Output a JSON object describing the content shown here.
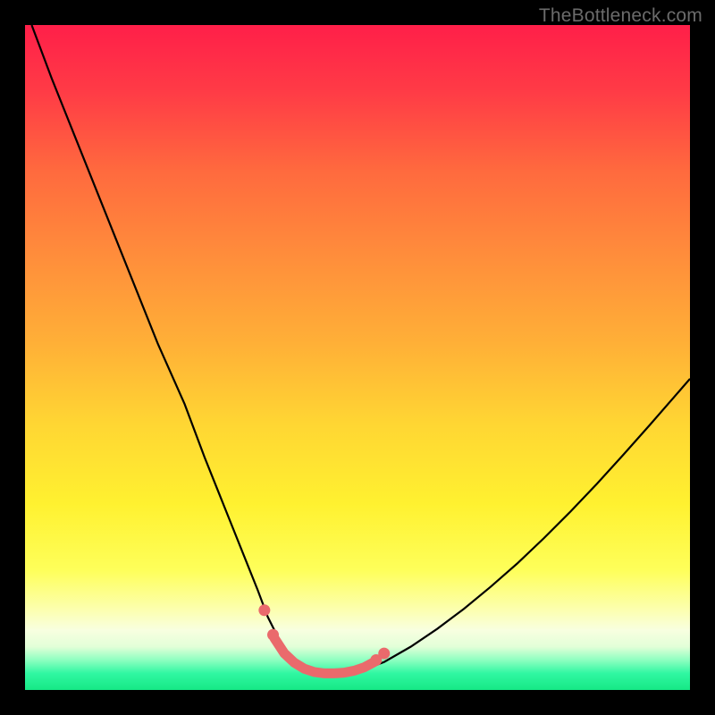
{
  "watermark": {
    "text": "TheBottleneck.com"
  },
  "gradient": {
    "stops": [
      {
        "offset": 0.0,
        "color": "#ff1f49"
      },
      {
        "offset": 0.1,
        "color": "#ff3b46"
      },
      {
        "offset": 0.22,
        "color": "#ff6a3e"
      },
      {
        "offset": 0.35,
        "color": "#ff8e3b"
      },
      {
        "offset": 0.48,
        "color": "#ffb037"
      },
      {
        "offset": 0.6,
        "color": "#ffd633"
      },
      {
        "offset": 0.72,
        "color": "#fff130"
      },
      {
        "offset": 0.82,
        "color": "#feff5a"
      },
      {
        "offset": 0.88,
        "color": "#fcffb0"
      },
      {
        "offset": 0.91,
        "color": "#f8ffe0"
      },
      {
        "offset": 0.935,
        "color": "#e2ffd8"
      },
      {
        "offset": 0.955,
        "color": "#8dffc0"
      },
      {
        "offset": 0.975,
        "color": "#30f7a2"
      },
      {
        "offset": 1.0,
        "color": "#16e885"
      }
    ]
  },
  "chart_data": {
    "type": "line",
    "title": "",
    "xlabel": "",
    "ylabel": "",
    "xlim": [
      0,
      100
    ],
    "ylim": [
      0,
      100
    ],
    "series": [
      {
        "name": "bottleneck-curve",
        "stroke": "#000000",
        "stroke_width": 2.2,
        "x": [
          1,
          4,
          8,
          12,
          16,
          20,
          24,
          27,
          29,
          31,
          33,
          35,
          36.5,
          38,
          40,
          42,
          44,
          46,
          48,
          50,
          54,
          58,
          62,
          66,
          70,
          74,
          78,
          82,
          86,
          90,
          94,
          98,
          100
        ],
        "y": [
          100,
          92,
          82,
          72,
          62,
          52,
          43,
          35,
          30,
          25,
          20,
          15,
          11,
          8,
          5,
          3.3,
          2.6,
          2.5,
          2.5,
          2.7,
          4.2,
          6.5,
          9.2,
          12.2,
          15.5,
          19.0,
          22.8,
          26.8,
          31.0,
          35.4,
          39.9,
          44.5,
          46.8
        ]
      },
      {
        "name": "valley-highlight",
        "stroke": "#ea6a6c",
        "stroke_width": 11,
        "linecap": "round",
        "x": [
          37.5,
          39,
          40.5,
          42,
          43.5,
          45,
          46.5,
          48,
          49.5,
          51,
          52.5
        ],
        "y": [
          7.8,
          5.5,
          4.1,
          3.2,
          2.7,
          2.5,
          2.5,
          2.6,
          2.9,
          3.4,
          4.2
        ]
      }
    ],
    "markers": [
      {
        "name": "dot-left-1",
        "cx": 36.0,
        "cy": 12.0,
        "r": 6.5,
        "fill": "#ea6a6c"
      },
      {
        "name": "dot-left-2",
        "cx": 37.3,
        "cy": 8.3,
        "r": 6.5,
        "fill": "#ea6a6c"
      },
      {
        "name": "dot-right-1",
        "cx": 52.8,
        "cy": 4.5,
        "r": 6.5,
        "fill": "#ea6a6c"
      },
      {
        "name": "dot-right-2",
        "cx": 54.0,
        "cy": 5.5,
        "r": 6.5,
        "fill": "#ea6a6c"
      }
    ]
  }
}
